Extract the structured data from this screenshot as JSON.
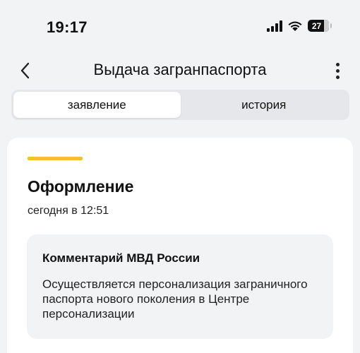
{
  "status_bar": {
    "time": "19:17",
    "battery": "27",
    "icons": [
      "signal-icon",
      "wifi-icon",
      "battery-icon"
    ]
  },
  "nav": {
    "title": "Выдача загранпаспорта",
    "icons": [
      "back-chevron-icon",
      "more-vertical-icon"
    ]
  },
  "tabs": [
    {
      "label": "заявление",
      "active": true
    },
    {
      "label": "история",
      "active": false
    }
  ],
  "card": {
    "accent_color": "#f2c12e",
    "title": "Оформление",
    "date": "сегодня в 12:51",
    "comment": {
      "title": "Комментарий МВД России",
      "text": "Осуществляется персонализация заграничного паспорта нового поколения в Центре персонализации"
    }
  }
}
